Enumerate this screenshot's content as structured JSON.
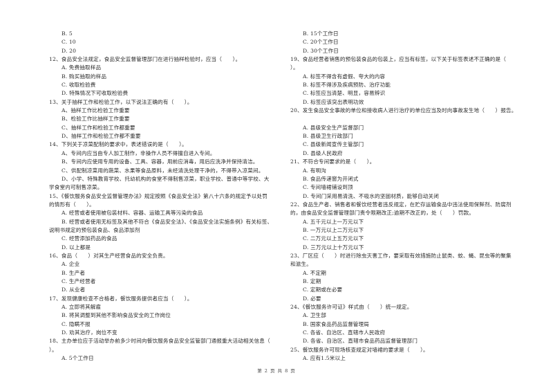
{
  "left_column": [
    {
      "type": "opt",
      "text": "B. 5"
    },
    {
      "type": "opt",
      "text": "C. 10"
    },
    {
      "type": "opt",
      "text": "D. 20"
    },
    {
      "type": "q",
      "text": "12、食品安全法规定，食品安全监督管理部门在进行抽样检验时，应当（　　）。"
    },
    {
      "type": "opt",
      "text": "A. 免费抽取样品"
    },
    {
      "type": "opt",
      "text": "B. 购买抽取的样品"
    },
    {
      "type": "opt",
      "text": "C. 收取检验费"
    },
    {
      "type": "opt",
      "text": "D. 特殊情况下可收取检验费"
    },
    {
      "type": "q",
      "text": "13、关于抽样工作和检验工作，以下说法正确的有（　　）。"
    },
    {
      "type": "opt",
      "text": "A、抽样工作比检验工作重要"
    },
    {
      "type": "opt",
      "text": "B、检验工作比抽样工作重要"
    },
    {
      "type": "opt",
      "text": "C、抽样工作和检验工作都重要"
    },
    {
      "type": "opt",
      "text": "D、抽样工作和检验工作都不重要"
    },
    {
      "type": "q",
      "text": "14、下列关于凉菜配制的要求中，表述错误的是（　　）。"
    },
    {
      "type": "opt",
      "text": "A、专间内应当由专人加工制作，非操作人员不得擅自进入专间。"
    },
    {
      "type": "opt",
      "text": "B、专间内应使用专用的设备、工具、容器，用前应消毒，用后应洗净并保持清洁。"
    },
    {
      "type": "opt",
      "text": "C、供配制凉菜用的蔬菜、水果等食品原料，未经清洗处理干净的，不得带入凉菜间。"
    },
    {
      "type": "opt",
      "text": "D、小学、特殊教育学校、托幼机构的食堂不得制售凉菜，职业学校、普通中等学校、大"
    },
    {
      "type": "cont",
      "text": "学食堂内可制售凉菜。"
    },
    {
      "type": "q",
      "text": "15、《餐饮服务食品安全监督管理办法》规定按照《食品安全法》第八十六条的规定予以处罚"
    },
    {
      "type": "cont",
      "text": "的情形有（　　）。"
    },
    {
      "type": "opt",
      "text": "A. 经营或者使用被包装材料、容器、运输工具等污染的食品"
    },
    {
      "type": "opt",
      "text": "B. 经营或者使用无标签及其他不符合《食品安全法》、《食品安全法实施条例》有关标签、"
    },
    {
      "type": "cont",
      "text": "说明书规定的预包装食品、食品添加剂"
    },
    {
      "type": "opt",
      "text": "C. 经营添加药品的食品"
    },
    {
      "type": "opt",
      "text": "D. 以上都是"
    },
    {
      "type": "q",
      "text": "16、食品（　　）对其生产经营食品的安全负责。"
    },
    {
      "type": "opt",
      "text": "A. 企业"
    },
    {
      "type": "opt",
      "text": "B. 生产者"
    },
    {
      "type": "opt",
      "text": "C. 生产经营者"
    },
    {
      "type": "opt",
      "text": "D. 从业者"
    },
    {
      "type": "q",
      "text": "17、发现健康检查不合格者，餐饮服务提供者应当（　　）。"
    },
    {
      "type": "opt",
      "text": "A. 立即将其解雇"
    },
    {
      "type": "opt",
      "text": "B. 将其调整到其他不影响食品安全的工作岗位"
    },
    {
      "type": "opt",
      "text": "C. 隐瞒不报"
    },
    {
      "type": "opt",
      "text": "D. 劝其治疗，岗位不变"
    },
    {
      "type": "q",
      "text": "18、主办单位应于活动举办前多少时间向餐饮服务食品安全监管部门通报重大活动相关信息（"
    },
    {
      "type": "cont",
      "text": "）。"
    },
    {
      "type": "opt",
      "text": "A. 5个工作日"
    }
  ],
  "right_column": [
    {
      "type": "opt",
      "text": "B. 15个工作日"
    },
    {
      "type": "opt",
      "text": "C. 20个工作日"
    },
    {
      "type": "opt",
      "text": "D. 30个工作日"
    },
    {
      "type": "q",
      "text": "19、食品经营者销售的预包装食品的包装上，应当有标签，以下关于标签表述不正确的是（"
    },
    {
      "type": "cont",
      "text": "）。"
    },
    {
      "type": "opt",
      "text": "A. 标签不得含有虚假、夸大的内容"
    },
    {
      "type": "opt",
      "text": "B. 标签不得涉及疾病预防、治疗功能"
    },
    {
      "type": "opt",
      "text": "C. 标签应当清楚、明显，容易辨识"
    },
    {
      "type": "opt",
      "text": "D. 标签应该突出表明功效"
    },
    {
      "type": "q",
      "text": "20、发生食品安全事故的单位和接收病人进行治疗的单位应当及时向事故发生地（　　）报告。"
    },
    {
      "type": "gap",
      "text": ""
    },
    {
      "type": "opt",
      "text": "A. 县级安全生产监督部门"
    },
    {
      "type": "opt",
      "text": "B. 县级卫生行政部门"
    },
    {
      "type": "opt",
      "text": "C. 县级新闻宣传主管部门"
    },
    {
      "type": "opt",
      "text": "D. 县级人民政府"
    },
    {
      "type": "q",
      "text": "21、不符合专间要求的是（　　）。"
    },
    {
      "type": "opt",
      "text": "A. 有明沟"
    },
    {
      "type": "opt",
      "text": "B. 食品传递窗为开闭式"
    },
    {
      "type": "opt",
      "text": "C. 专间墙裙铺设到顶"
    },
    {
      "type": "opt",
      "text": "D. 专间门采用易清洗、不吸水的坚固材质，能够自动关闭"
    },
    {
      "type": "q",
      "text": "22、食品生产者、销售者和餐饮经营者违反规定，在贮存运输食品中违法使用保鲜剂、防腐剂"
    },
    {
      "type": "cont",
      "text": "的，由食品安全监督管理部门责令限期改正;逾期不改正的，处（　　）罚款。"
    },
    {
      "type": "opt",
      "text": "A. 五千元以上一万元以下"
    },
    {
      "type": "opt",
      "text": "B. 一万元以上二万元以下"
    },
    {
      "type": "opt",
      "text": "C. 二万元以上五万元以下"
    },
    {
      "type": "opt",
      "text": "D. 三万元以上十万元以下"
    },
    {
      "type": "q",
      "text": "23、厂区应（　　）时进行除虫灭害工作，要采取有效措施防止鼠类、蚊、蝇、昆虫等的聚集"
    },
    {
      "type": "cont",
      "text": "和滋生。"
    },
    {
      "type": "opt",
      "text": "A. 不定期"
    },
    {
      "type": "opt",
      "text": "B. 定期"
    },
    {
      "type": "opt",
      "text": "C. 定期或在必要"
    },
    {
      "type": "opt",
      "text": "D. 必要"
    },
    {
      "type": "q",
      "text": "24、《餐饮服务许可证》样式由（　　）统一规定。"
    },
    {
      "type": "opt",
      "text": "A. 卫生部"
    },
    {
      "type": "opt",
      "text": "B. 国家食品药品监督管理局"
    },
    {
      "type": "opt",
      "text": "C. 各省、自治区、直辖市人民政府"
    },
    {
      "type": "opt",
      "text": "D. 各省、自治区、直辖市食品药品监督管理部门"
    },
    {
      "type": "q",
      "text": "25、餐饮服务许可现场核查规定对墙裙的要求是（　　）。"
    },
    {
      "type": "opt",
      "text": "A. 应有1.5米以上"
    }
  ],
  "footer": {
    "page_label": "第 2 页 共 8 页"
  }
}
